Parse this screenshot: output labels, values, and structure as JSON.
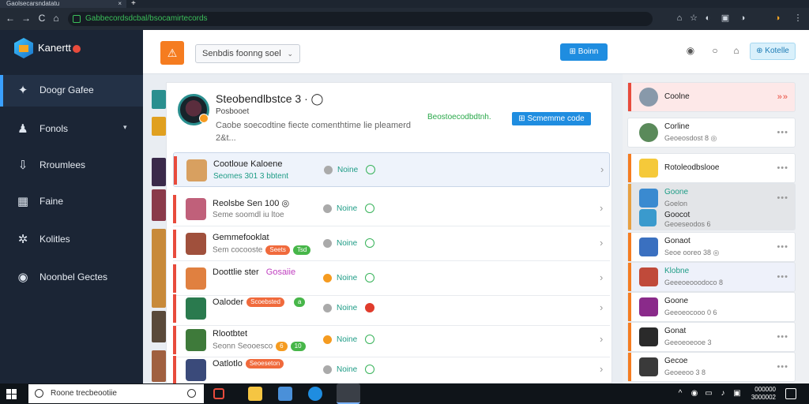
{
  "browser": {
    "tab_title": "Gaolsecarsndatatu",
    "tab_close": "×",
    "new_tab": "+",
    "url": "Gabbecordsdcbal/bsocamirtecords",
    "nav": {
      "back": "←",
      "forward": "→",
      "reload": "C",
      "home": "⌂"
    },
    "toolbar_icons": [
      "⌂",
      "☆",
      "◐",
      "▣",
      "◑",
      "⋮"
    ]
  },
  "sidebar": {
    "logo_text": "Kanertt",
    "items": [
      {
        "label": "Doogr Gafee",
        "icon": "puzzle-icon",
        "glyph": "✦",
        "active": true
      },
      {
        "label": "Fonols",
        "icon": "people-icon",
        "glyph": "♟",
        "caret": "▾"
      },
      {
        "label": "Rroumlees",
        "icon": "download-icon",
        "glyph": "⇩"
      },
      {
        "label": "Faine",
        "icon": "calendar-icon",
        "glyph": "▦"
      },
      {
        "label": "Kolitles",
        "icon": "settings-icon",
        "glyph": "✲"
      },
      {
        "label": "Noonbel Gectes",
        "icon": "circle-icon",
        "glyph": "◉"
      }
    ]
  },
  "topbar": {
    "app_icon_glyph": "⚠",
    "dropdown_value": "Senbdis foonng soel",
    "dropdown_chevron": "⌄",
    "primary_button": "Boinn",
    "primary_button_glyph": "⊞",
    "icons": [
      "◉",
      "○",
      "⌂"
    ],
    "light_button": "Kotelle",
    "light_button_glyph": "⊕"
  },
  "profile": {
    "title": "Steobendlbstce 3 · ◯",
    "subtitle": "Posbooet",
    "description": "Caobe soecodtine fiecte comenthtime lie pleamerd 2&t...",
    "link": "Beostoecodbdtnh.",
    "button": "Scmemme code",
    "button_glyph": "⊞"
  },
  "rows": [
    {
      "name": "Cootloue Kaloene",
      "meta": "Seomes 301 3 bbtent",
      "status": "Noine",
      "highlighted": true,
      "thumb": "#d8a060",
      "bar": "#e84b3c"
    },
    {
      "name": "Reolsbe Sen 100 ◎",
      "meta": "Seme soomdl iu ltoe",
      "status": "Noine",
      "thumb": "#c0607a",
      "bar": "#e84b3c"
    },
    {
      "name": "Gemmefooklat",
      "meta": "Sem cocooste",
      "pill1": "Seets",
      "pill1_color": "#f06a3c",
      "pill2": "Tsd",
      "pill2_color": "#47b649",
      "status": "Noine",
      "thumb": "#a0503c",
      "bar": "#e84b3c"
    },
    {
      "name": "Doottlie ster",
      "meta": "",
      "tag": "Gosaiie",
      "status": "Noine",
      "status_dot": "#f59b20",
      "thumb": "#e08040",
      "bar": "#e84b3c"
    },
    {
      "name": "Oaloder",
      "meta": "",
      "pill1": "Scoebsted",
      "pill1_color": "#f06a3c",
      "pill2": "a",
      "pill2_color": "#47b649",
      "status": "Noine",
      "fail": true,
      "thumb": "#2a7a4e",
      "bar": "#e84b3c"
    },
    {
      "name": "Rlootbtet",
      "meta": "Seonn Seooesco",
      "pill1": "6",
      "pill1_color": "#f59b20",
      "pill2": "10",
      "pill2_color": "#47b649",
      "status": "Noine",
      "status_dot": "#f59b20",
      "thumb": "#3e7a3a",
      "bar": "#e84b3c"
    },
    {
      "name": "Oatlotlo",
      "meta": "",
      "pill1": "Seoeseton",
      "pill1_color": "#f06a3c",
      "status": "Noine",
      "thumb": "#3a4a7a",
      "bar": "#e84b3c"
    }
  ],
  "right_panel": [
    {
      "title": "Coolne",
      "sub": "",
      "bg": "#fde8e8",
      "bar": "#e84b3c",
      "icon": "#8899aa",
      "more": "»»"
    },
    {
      "title": "Corline",
      "sub": "Geoeosdost 8 ◎",
      "bar": "#fff",
      "icon": "#5a8a5a",
      "more": "•••"
    },
    {
      "title": "Rotoleodbslooe",
      "sub": "",
      "bar": "#f57c20",
      "icon": "#f5c93a",
      "more": "•••"
    },
    {
      "title": "Goone",
      "sub": "Goelon",
      "bg": "#e3e5e8",
      "bar": "#e8a040",
      "icon": "#3a8ad0",
      "more": "•••",
      "badges": true
    },
    {
      "title": "Goocot",
      "sub": "Geoeseodos 6",
      "bg": "#e3e5e8",
      "bar": "#e8a040",
      "icon": "#3a9acd",
      "more": ""
    },
    {
      "title": "Gonaot",
      "sub": "Seoe ooreo 38 ◎",
      "bar": "#f57c20",
      "icon": "#3a70c0",
      "more": "•••"
    },
    {
      "title": "Klobne",
      "sub": "Geeeoeooodoco 8",
      "bg": "#eef1fa",
      "bar": "#f57c20",
      "icon": "#c04a3a",
      "more": "•••"
    },
    {
      "title": "Goone",
      "sub": "Geeoeocooo 0 6",
      "bar": "#f57c20",
      "icon": "#8a2a8a",
      "more": "•••"
    },
    {
      "title": "Gonat",
      "sub": "Geeoeoeooe 3",
      "bar": "#f57c20",
      "icon": "#2a2a2a",
      "more": "•••"
    },
    {
      "title": "Gecoe",
      "sub": "Geoeeoo 3 8",
      "bar": "#f57c20",
      "icon": "#3a3a3a",
      "more": "•••"
    }
  ],
  "taskbar": {
    "search_placeholder": "Roone trecbeootiie",
    "tray": [
      "^",
      "◉",
      "▭",
      "♪",
      "▣"
    ],
    "time": "000000",
    "date": "3000002"
  }
}
